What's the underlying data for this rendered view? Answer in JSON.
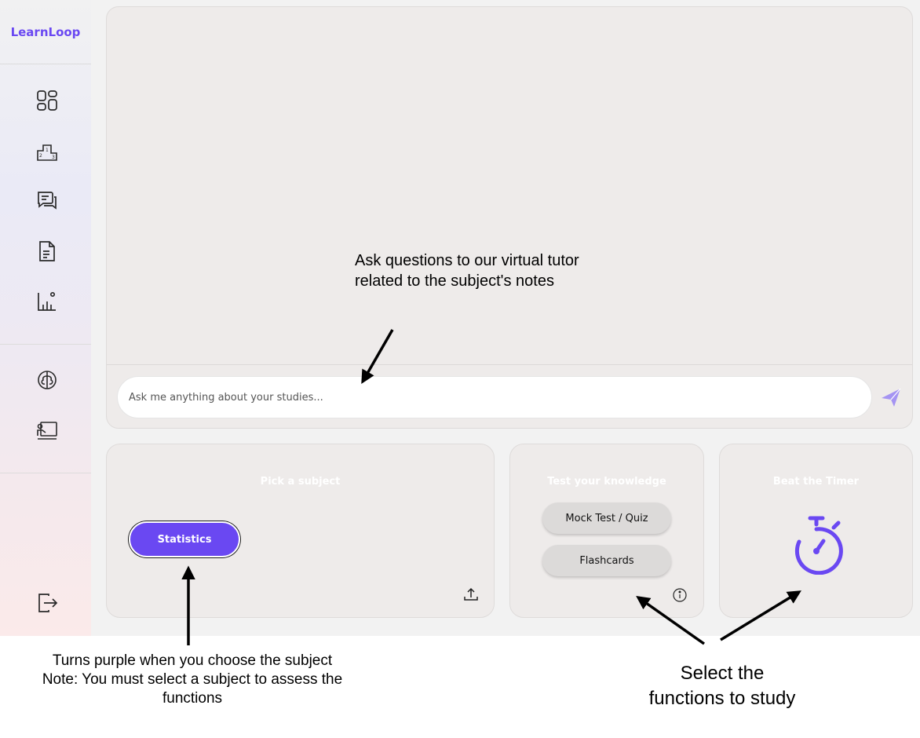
{
  "app": {
    "brand": "LearnLoop",
    "accent_color": "#6a48f2"
  },
  "sidebar": {
    "items": [
      {
        "icon": "dashboard-grid-icon"
      },
      {
        "icon": "leaderboard-podium-icon"
      },
      {
        "icon": "chat-bubbles-icon"
      },
      {
        "icon": "notes-document-icon"
      },
      {
        "icon": "statistics-chart-icon"
      },
      {
        "icon": "brain-icon"
      },
      {
        "icon": "presentation-board-icon"
      }
    ],
    "logout_icon": "logout-icon"
  },
  "chat": {
    "placeholder": "Ask me anything about your studies...",
    "send_icon": "send-icon"
  },
  "subject_card": {
    "title": "Pick a subject",
    "selected_subject": "Statistics",
    "upload_icon": "upload-icon"
  },
  "knowledge_card": {
    "title": "Test your knowledge",
    "mock_test_label": "Mock Test / Quiz",
    "flashcards_label": "Flashcards",
    "info_icon": "info-icon"
  },
  "timer_card": {
    "title": "Beat the Timer",
    "timer_icon": "stopwatch-icon"
  },
  "annotations": {
    "tutor_note": "Ask questions to our virtual tutor related to the subject's notes",
    "purple_note_line1": "Turns purple when you choose the subject",
    "purple_note_line2": "Note: You must select a subject to assess the functions",
    "study_note": "Select the functions to study"
  }
}
